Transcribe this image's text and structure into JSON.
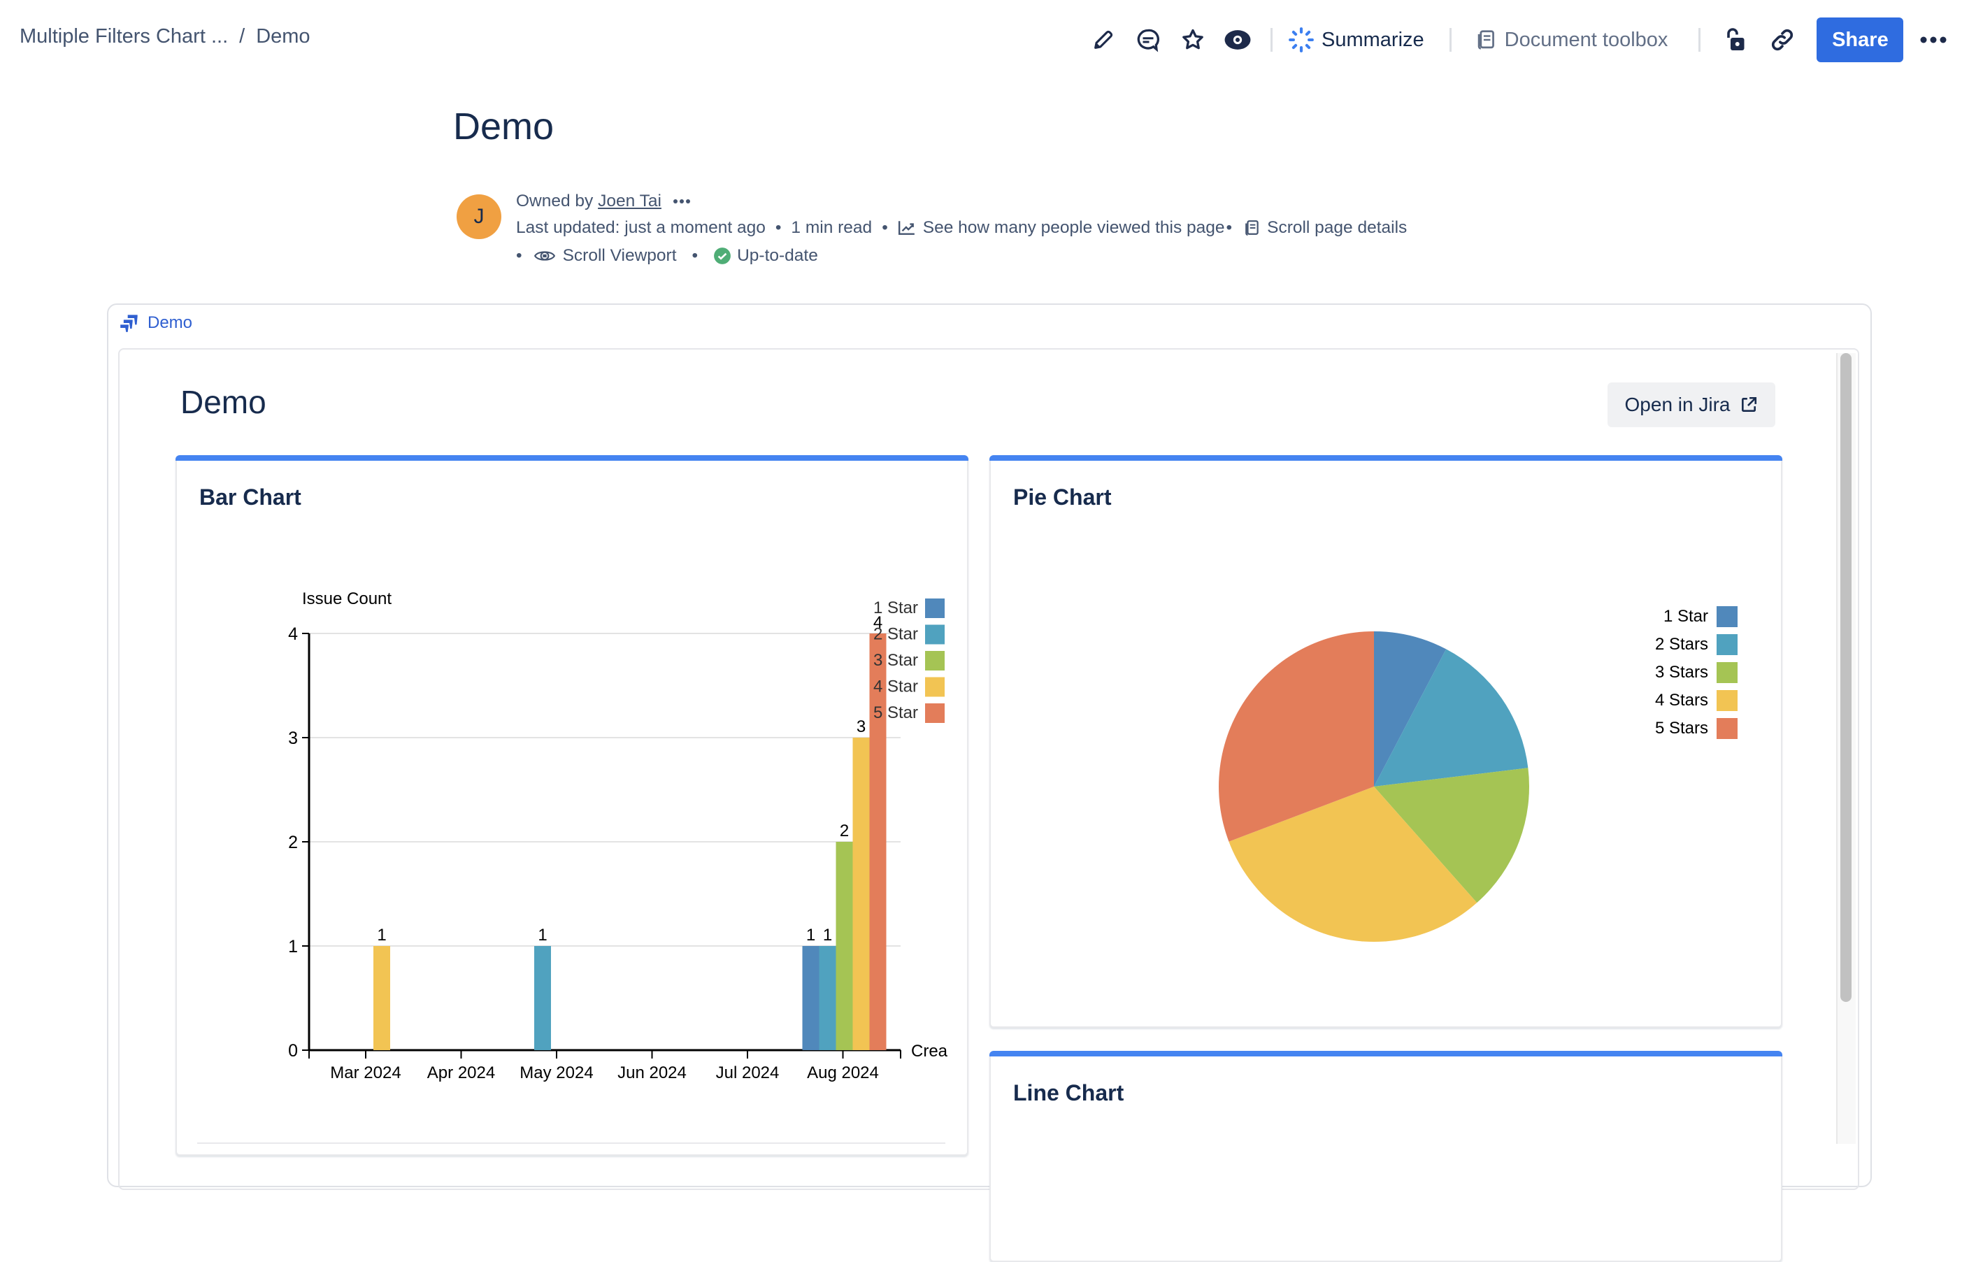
{
  "breadcrumb": {
    "parent": "Multiple Filters Chart ...",
    "separator": "/",
    "current": "Demo"
  },
  "toolbar": {
    "icons": [
      "edit-icon",
      "comment-icon",
      "star-icon",
      "watch-icon"
    ],
    "summarize_label": "Summarize",
    "document_toolbox_label": "Document toolbox",
    "share_label": "Share"
  },
  "page": {
    "title": "Demo",
    "avatar_initial": "J",
    "owned_by_label": "Owned by",
    "owner_name": "Joen Tai",
    "last_updated": "Last updated: just a moment ago",
    "read_time": "1 min read",
    "analytics_link": "See how many people viewed this page",
    "scroll_page_details": "Scroll page details",
    "scroll_viewport": "Scroll Viewport",
    "status": "Up-to-date"
  },
  "macro": {
    "link_label": "Demo",
    "dashboard_title": "Demo",
    "open_in_jira_label": "Open in Jira"
  },
  "colors": {
    "accent": "#4584f1",
    "share_button": "#2f6ce0",
    "avatar": "#f0a042",
    "status_green": "#4fad76",
    "series": [
      "#5088bb",
      "#50a2bf",
      "#a5c454",
      "#f2c453",
      "#e37d5a"
    ]
  },
  "cards": {
    "bar_title": "Bar Chart",
    "pie_title": "Pie Chart",
    "line_title": "Line Chart"
  },
  "chart_data": [
    {
      "type": "bar",
      "title": "Bar Chart",
      "ylabel": "Issue Count",
      "xlabel": "Crea",
      "ylim": [
        0,
        4
      ],
      "yticks": [
        "0",
        "1",
        "2",
        "3",
        "4"
      ],
      "grid": true,
      "legend_position": "top-right",
      "x_ticks": [
        "Mar 2024",
        "Apr 2024",
        "May 2024",
        "Jun 2024",
        "Jul 2024",
        "Aug 2024"
      ],
      "series": [
        {
          "name": "1 Star",
          "points": [
            {
              "period": "Aug 2024",
              "value": 1
            }
          ]
        },
        {
          "name": "2 Star",
          "points": [
            {
              "period": "May 2024",
              "value": 1
            },
            {
              "period": "Aug 2024",
              "value": 1
            }
          ]
        },
        {
          "name": "3 Star",
          "points": [
            {
              "period": "Aug 2024",
              "value": 2
            }
          ]
        },
        {
          "name": "4 Star",
          "points": [
            {
              "period": "Mar 2024",
              "value": 1
            },
            {
              "period": "Aug 2024",
              "value": 3
            }
          ]
        },
        {
          "name": "5 Star",
          "points": [
            {
              "period": "Aug 2024",
              "value": 4
            }
          ]
        }
      ]
    },
    {
      "type": "pie",
      "title": "Pie Chart",
      "legend_position": "top-right",
      "categories": [
        "1 Star",
        "2 Stars",
        "3 Stars",
        "4 Stars",
        "5 Stars"
      ],
      "values": [
        1,
        2,
        2,
        4,
        4
      ]
    },
    {
      "type": "line",
      "title": "Line Chart"
    }
  ]
}
